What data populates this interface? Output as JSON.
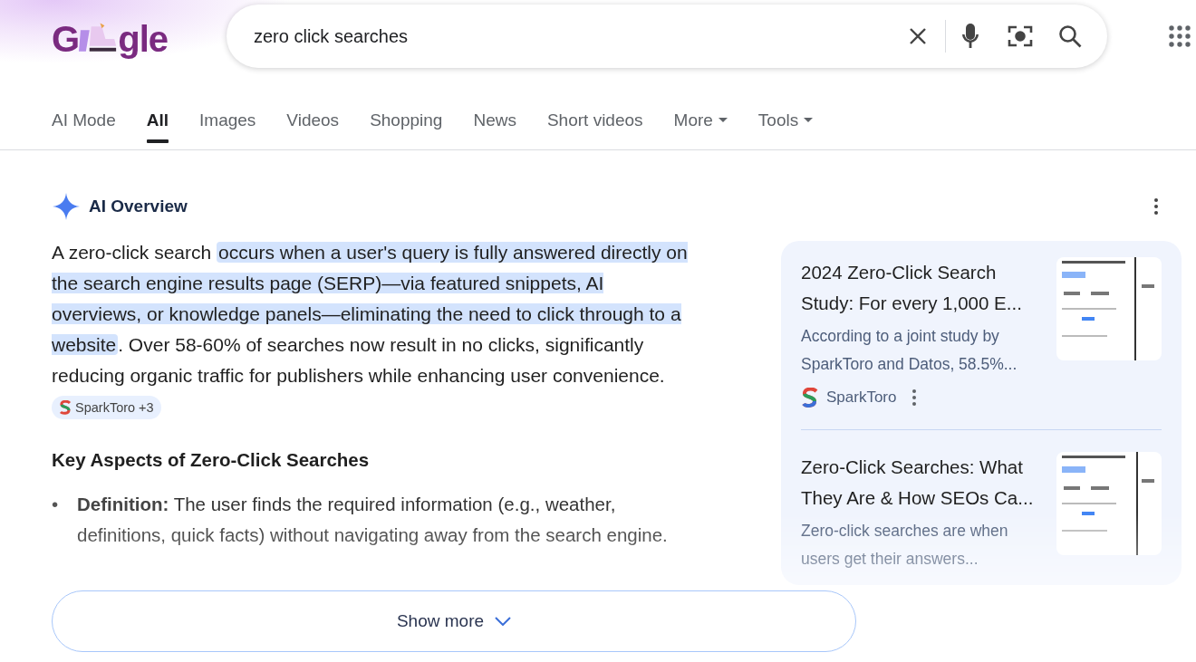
{
  "logo": {
    "left": "G",
    "right": "gle"
  },
  "search": {
    "value": "zero click searches"
  },
  "tabs": [
    {
      "label": "AI Mode",
      "selected": false,
      "has_menu": false
    },
    {
      "label": "All",
      "selected": true,
      "has_menu": false
    },
    {
      "label": "Images",
      "selected": false,
      "has_menu": false
    },
    {
      "label": "Videos",
      "selected": false,
      "has_menu": false
    },
    {
      "label": "Shopping",
      "selected": false,
      "has_menu": false
    },
    {
      "label": "News",
      "selected": false,
      "has_menu": false
    },
    {
      "label": "Short videos",
      "selected": false,
      "has_menu": false
    },
    {
      "label": "More",
      "selected": false,
      "has_menu": true
    },
    {
      "label": "Tools",
      "selected": false,
      "has_menu": true
    }
  ],
  "ai_overview": {
    "title": "AI Overview",
    "paragraph": [
      {
        "text": "A zero-click search ",
        "highlighted": false
      },
      {
        "text": "occurs when a user's query is fully answered directly on the search engine results page (SERP)—via featured snippets, AI overviews, or knowledge panels—eliminating the need to click through to a website",
        "highlighted": true
      },
      {
        "text": ". Over 58-60% of searches now result in no clicks, significantly reducing organic traffic for publishers while enhancing user convenience.",
        "highlighted": false
      }
    ],
    "citation": "SparkToro +3",
    "heading": "Key Aspects of Zero-Click Searches",
    "bullets": [
      {
        "marker": "•",
        "text": "**Definition:** The user finds the required information (e.g., weather, definitions, quick facts) without navigating away from the search engine."
      }
    ],
    "show_more": "Show more",
    "sources": [
      {
        "title": "2024 Zero-Click Search Study: For every 1,000 E...",
        "snippet": "According to a joint study by SparkToro and Datos, 58.5%...",
        "site": "SparkToro"
      },
      {
        "title": "Zero-Click Searches: What They Are & How SEOs Ca...",
        "snippet": "Zero-click searches are when users get their answers..."
      }
    ]
  }
}
